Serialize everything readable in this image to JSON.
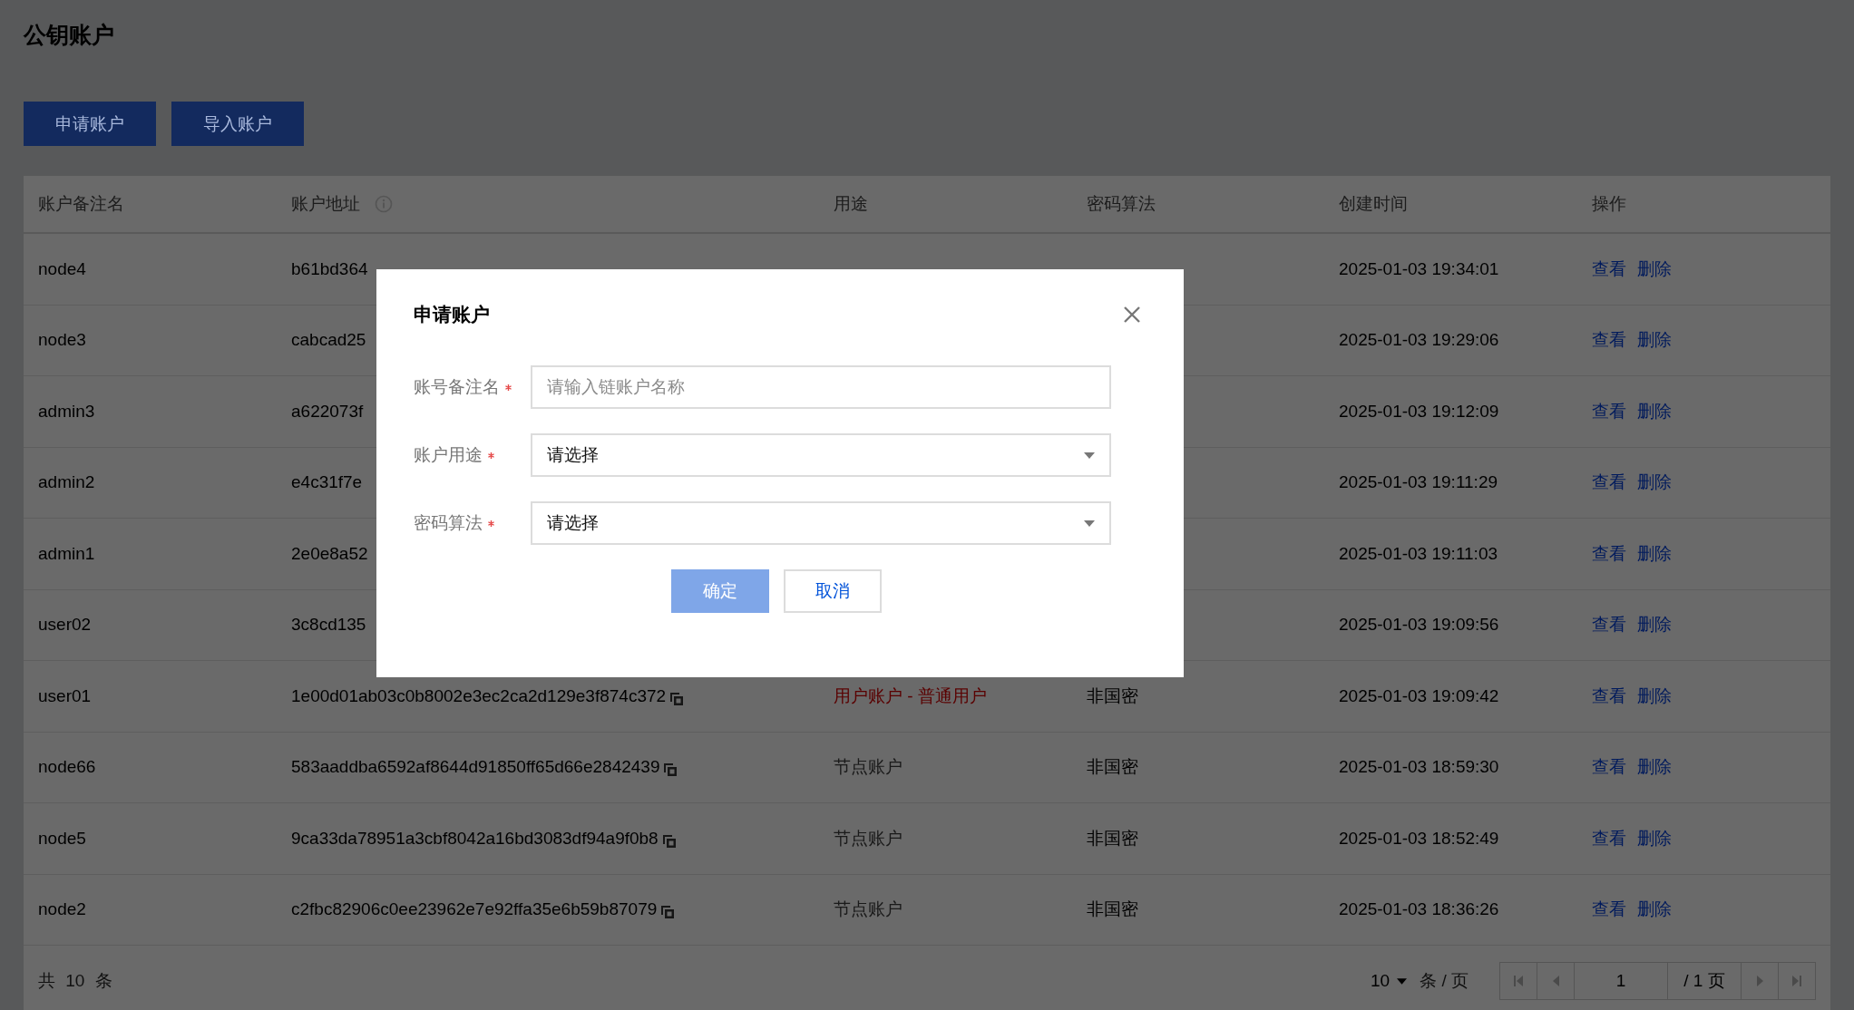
{
  "page": {
    "title": "公钥账户"
  },
  "toolbar": {
    "buttons": [
      "申请账户",
      "导入账户"
    ]
  },
  "table": {
    "columns": [
      {
        "label": "账户备注名",
        "info": false
      },
      {
        "label": "账户地址",
        "info": true
      },
      {
        "label": "用途",
        "info": false
      },
      {
        "label": "密码算法",
        "info": false
      },
      {
        "label": "创建时间",
        "info": false
      },
      {
        "label": "操作",
        "info": false
      }
    ],
    "rows": [
      {
        "name": "node4",
        "address": "b61bd364",
        "copy_icon": false,
        "created": "2025-01-03 19:34:01",
        "actions": [
          "查看",
          "删除"
        ]
      },
      {
        "name": "node3",
        "address": "cabcad25",
        "copy_icon": false,
        "created": "2025-01-03 19:29:06",
        "actions": [
          "查看",
          "删除"
        ]
      },
      {
        "name": "admin3",
        "address": "a622073f",
        "copy_icon": false,
        "created": "2025-01-03 19:12:09",
        "actions": [
          "查看",
          "删除"
        ]
      },
      {
        "name": "admin2",
        "address": "e4c31f7e",
        "copy_icon": false,
        "created": "2025-01-03 19:11:29",
        "actions": [
          "查看",
          "删除"
        ]
      },
      {
        "name": "admin1",
        "address": "2e0e8a52",
        "copy_icon": false,
        "created": "2025-01-03 19:11:03",
        "actions": [
          "查看",
          "删除"
        ]
      },
      {
        "name": "user02",
        "address": "3c8cd135",
        "copy_icon": false,
        "created": "2025-01-03 19:09:56",
        "actions": [
          "查看",
          "删除"
        ]
      },
      {
        "name": "user01",
        "address": "1e00d01ab03c0b8002e3ec2ca2d129e3f874c372",
        "copy_icon": true,
        "usage": {
          "text": "用户账户 - 普通用户",
          "color": "#5a0000"
        },
        "crypto": "非国密",
        "created": "2025-01-03 19:09:42",
        "actions": [
          "查看",
          "删除"
        ]
      },
      {
        "name": "node66",
        "address": "583aaddba6592af8644d91850ff65d66e2842439",
        "copy_icon": true,
        "usage": {
          "text": "节点账户",
          "color": "#1a1a1a"
        },
        "crypto": "非国密",
        "created": "2025-01-03 18:59:30",
        "actions": [
          "查看",
          "删除"
        ]
      },
      {
        "name": "node5",
        "address": "9ca33da78951a3cbf8042a16bd3083df94a9f0b8",
        "copy_icon": true,
        "usage": {
          "text": "节点账户",
          "color": "#1a1a1a"
        },
        "crypto": "非国密",
        "created": "2025-01-03 18:52:49",
        "actions": [
          "查看",
          "删除"
        ]
      },
      {
        "name": "node2",
        "address": "c2fbc82906c0ee23962e7e92ffa35e6b59b87079",
        "copy_icon": true,
        "usage": {
          "text": "节点账户",
          "color": "#1a1a1a"
        },
        "crypto": "非国密",
        "created": "2025-01-03 18:36:26",
        "actions": [
          "查看",
          "删除"
        ]
      }
    ]
  },
  "pagination": {
    "total": "共 10 条",
    "page_size": "10",
    "per_page_label": "条 / 页",
    "page": "1",
    "total_pages": "/ 1 页",
    "first_disabled": true,
    "last_disabled": true
  },
  "dialog": {
    "title": "申请账户",
    "fields": [
      {
        "kind": "input",
        "label": "账号备注名",
        "required": true,
        "placeholder": "请输入链账户名称"
      },
      {
        "kind": "select",
        "label": "账户用途",
        "required": true,
        "value": "请选择"
      },
      {
        "kind": "select",
        "label": "密码算法",
        "required": true,
        "value": "请选择"
      }
    ],
    "buttons": [
      {
        "label": "确定",
        "kind": "primary",
        "disabled": true
      },
      {
        "label": "取消",
        "kind": "secondary",
        "disabled": false
      }
    ]
  }
}
